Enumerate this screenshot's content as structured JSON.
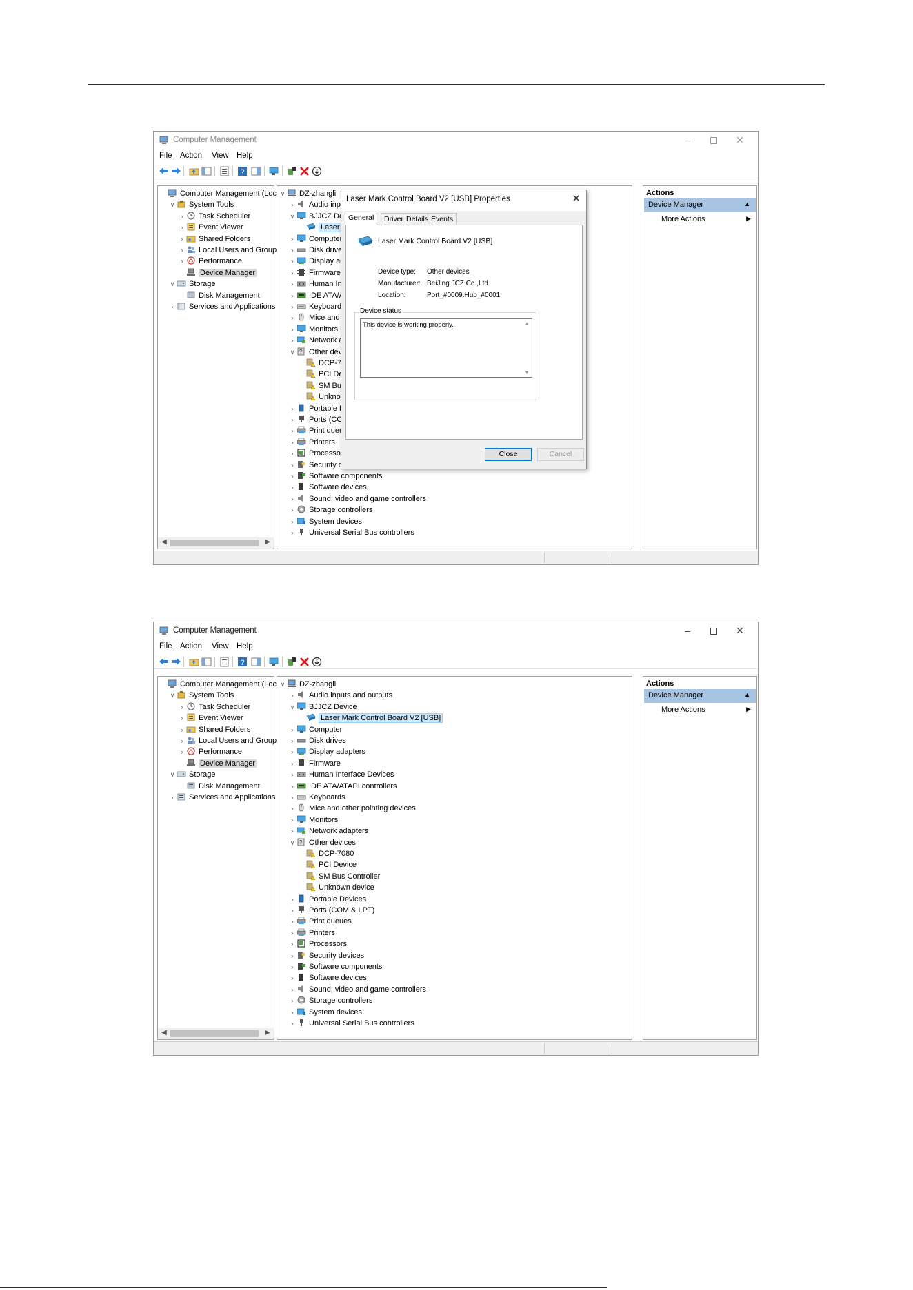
{
  "window_title": "Computer Management",
  "menu": [
    "File",
    "Action",
    "View",
    "Help"
  ],
  "left_tree": [
    {
      "label": "Computer Management (Local",
      "icon": "computer-management-icon",
      "level": 0,
      "expander": ""
    },
    {
      "label": "System Tools",
      "icon": "tools-icon",
      "level": 1,
      "expander": "v"
    },
    {
      "label": "Task Scheduler",
      "icon": "clock-icon",
      "level": 2,
      "expander": ">"
    },
    {
      "label": "Event Viewer",
      "icon": "event-viewer-icon",
      "level": 2,
      "expander": ">"
    },
    {
      "label": "Shared Folders",
      "icon": "shared-folder-icon",
      "level": 2,
      "expander": ">"
    },
    {
      "label": "Local Users and Groups",
      "icon": "users-icon",
      "level": 2,
      "expander": ">"
    },
    {
      "label": "Performance",
      "icon": "performance-icon",
      "level": 2,
      "expander": ">"
    },
    {
      "label": "Device Manager",
      "icon": "device-manager-icon",
      "level": 2,
      "expander": "",
      "selected": true
    },
    {
      "label": "Storage",
      "icon": "storage-icon",
      "level": 1,
      "expander": "v"
    },
    {
      "label": "Disk Management",
      "icon": "disk-management-icon",
      "level": 2,
      "expander": ""
    },
    {
      "label": "Services and Applications",
      "icon": "services-icon",
      "level": 1,
      "expander": ">"
    }
  ],
  "device_tree": [
    {
      "label": "DZ-zhangli",
      "icon": "computer-icon",
      "level": 0,
      "expander": "v"
    },
    {
      "label": "Audio inputs and outputs",
      "icon": "speaker-icon",
      "level": 1,
      "expander": ">"
    },
    {
      "label": "BJJCZ Device",
      "icon": "monitor-icon",
      "level": 1,
      "expander": "v"
    },
    {
      "label": "Laser Mark Control Board V2 [USB]",
      "icon": "usb-board-icon",
      "level": 2,
      "expander": "",
      "highlight": true
    },
    {
      "label": "Computer",
      "icon": "monitor-icon",
      "level": 1,
      "expander": ">"
    },
    {
      "label": "Disk drives",
      "icon": "disk-icon",
      "level": 1,
      "expander": ">"
    },
    {
      "label": "Display adapters",
      "icon": "display-icon",
      "level": 1,
      "expander": ">"
    },
    {
      "label": "Firmware",
      "icon": "firmware-icon",
      "level": 1,
      "expander": ">"
    },
    {
      "label": "Human Interface Devices",
      "icon": "hid-icon",
      "level": 1,
      "expander": ">"
    },
    {
      "label": "IDE ATA/ATAPI controllers",
      "icon": "ide-icon",
      "level": 1,
      "expander": ">"
    },
    {
      "label": "Keyboards",
      "icon": "keyboard-icon",
      "level": 1,
      "expander": ">"
    },
    {
      "label": "Mice and other pointing devices",
      "icon": "mouse-icon",
      "level": 1,
      "expander": ">"
    },
    {
      "label": "Monitors",
      "icon": "monitor-icon",
      "level": 1,
      "expander": ">"
    },
    {
      "label": "Network adapters",
      "icon": "network-icon",
      "level": 1,
      "expander": ">"
    },
    {
      "label": "Other devices",
      "icon": "other-devices-icon",
      "level": 1,
      "expander": "v"
    },
    {
      "label": "DCP-7080",
      "icon": "warning-device-icon",
      "level": 2,
      "expander": ""
    },
    {
      "label": "PCI Device",
      "icon": "warning-device-icon",
      "level": 2,
      "expander": ""
    },
    {
      "label": "SM Bus Controller",
      "icon": "warning-device-icon",
      "level": 2,
      "expander": ""
    },
    {
      "label": "Unknown device",
      "icon": "warning-device-icon",
      "level": 2,
      "expander": ""
    },
    {
      "label": "Portable Devices",
      "icon": "portable-icon",
      "level": 1,
      "expander": ">"
    },
    {
      "label": "Ports (COM & LPT)",
      "icon": "port-icon",
      "level": 1,
      "expander": ">"
    },
    {
      "label": "Print queues",
      "icon": "printer-icon",
      "level": 1,
      "expander": ">"
    },
    {
      "label": "Printers",
      "icon": "printer-icon",
      "level": 1,
      "expander": ">"
    },
    {
      "label": "Processors",
      "icon": "processor-icon",
      "level": 1,
      "expander": ">"
    },
    {
      "label": "Security devices",
      "icon": "security-icon",
      "level": 1,
      "expander": ">"
    },
    {
      "label": "Software components",
      "icon": "software-component-icon",
      "level": 1,
      "expander": ">"
    },
    {
      "label": "Software devices",
      "icon": "software-device-icon",
      "level": 1,
      "expander": ">"
    },
    {
      "label": "Sound, video and game controllers",
      "icon": "sound-icon",
      "level": 1,
      "expander": ">"
    },
    {
      "label": "Storage controllers",
      "icon": "storage-controller-icon",
      "level": 1,
      "expander": ">"
    },
    {
      "label": "System devices",
      "icon": "system-devices-icon",
      "level": 1,
      "expander": ">"
    },
    {
      "label": "Universal Serial Bus controllers",
      "icon": "usb-icon",
      "level": 1,
      "expander": ">"
    }
  ],
  "actions_panel": {
    "title": "Actions",
    "section": "Device Manager",
    "more": "More Actions"
  },
  "dialog": {
    "title": "Laser Mark Control Board V2 [USB] Properties",
    "tabs": [
      "General",
      "Driver",
      "Details",
      "Events"
    ],
    "device_name": "Laser Mark Control Board V2 [USB]",
    "device_type_label": "Device type:",
    "device_type": "Other devices",
    "manufacturer_label": "Manufacturer:",
    "manufacturer": "BeiJing JCZ Co.,Ltd",
    "location_label": "Location:",
    "location": "Port_#0009.Hub_#0001",
    "status_group": "Device status",
    "status_text": "This device is working properly.",
    "close_label": "Close",
    "cancel_label": "Cancel"
  },
  "colors": {
    "selection": "#d9d9d9",
    "highlight": "#cce8ff",
    "actions_header": "#a7c4e2"
  }
}
